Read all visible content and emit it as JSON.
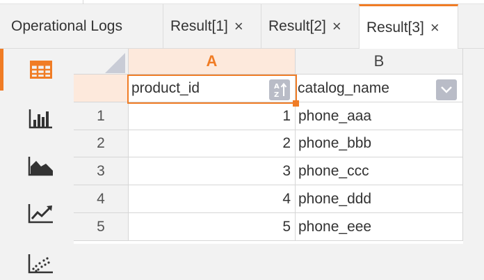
{
  "tabs": {
    "logs": {
      "label": "Operational Logs"
    },
    "results": [
      {
        "label": "Result[1]",
        "close": "×"
      },
      {
        "label": "Result[2]",
        "close": "×"
      },
      {
        "label": "Result[3]",
        "close": "×"
      }
    ],
    "active": "Result[3]"
  },
  "toolbar": {
    "views": [
      {
        "icon": "table-icon",
        "active": true
      },
      {
        "icon": "bar-chart-icon",
        "active": false
      },
      {
        "icon": "area-chart-icon",
        "active": false
      },
      {
        "icon": "line-chart-icon",
        "active": false
      },
      {
        "icon": "scatter-chart-icon",
        "active": false
      }
    ]
  },
  "grid": {
    "column_letters": [
      "A",
      "B"
    ],
    "fields": [
      "product_id",
      "catalog_name"
    ],
    "rows": [
      {
        "num": "1",
        "product_id": "1",
        "catalog_name": "phone_aaa"
      },
      {
        "num": "2",
        "product_id": "2",
        "catalog_name": "phone_bbb"
      },
      {
        "num": "3",
        "product_id": "3",
        "catalog_name": "phone_ccc"
      },
      {
        "num": "4",
        "product_id": "4",
        "catalog_name": "phone_ddd"
      },
      {
        "num": "5",
        "product_id": "5",
        "catalog_name": "phone_eee"
      }
    ],
    "selected_column": "A",
    "sort_icon": "sort-az-icon",
    "dropdown_icon": "chevron-down-icon"
  },
  "colors": {
    "accent": "#f07c25",
    "selected_bg": "#fde9dc",
    "header_bg": "#f2f2f2",
    "button_bg": "#b9bcc7"
  }
}
